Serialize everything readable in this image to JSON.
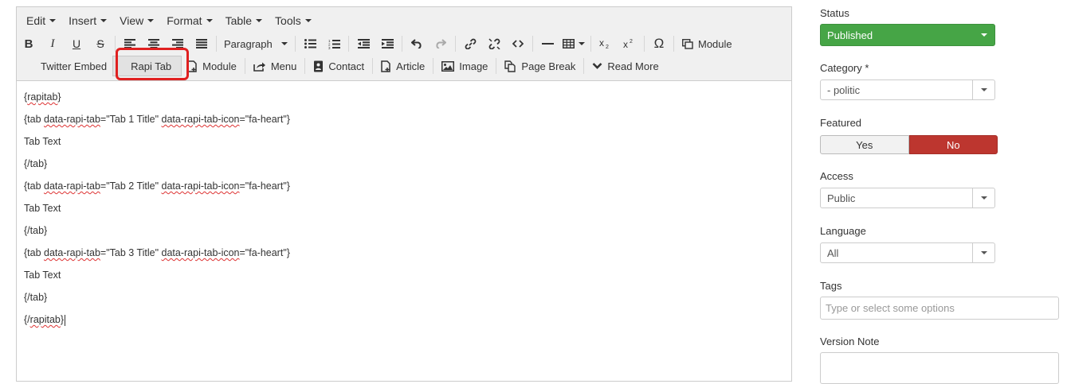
{
  "menubar": [
    "Edit",
    "Insert",
    "View",
    "Format",
    "Table",
    "Tools"
  ],
  "toolbar": {
    "format_select": "Paragraph",
    "module_label": "Module",
    "twitter_label": "Twitter Embed",
    "rapi_tab_label": "Rapi Tab",
    "module2_label": "Module",
    "menu_label": "Menu",
    "contact_label": "Contact",
    "article_label": "Article",
    "image_label": "Image",
    "pagebreak_label": "Page Break",
    "readmore_label": "Read More"
  },
  "content": {
    "lines": [
      "{rapitab}",
      "{tab data-rapi-tab=\"Tab 1 Title\" data-rapi-tab-icon=\"fa-heart\"}",
      "Tab Text",
      "{/tab}",
      "{tab data-rapi-tab=\"Tab 2 Title\" data-rapi-tab-icon=\"fa-heart\"}",
      "Tab Text",
      "{/tab}",
      "{tab data-rapi-tab=\"Tab 3 Title\" data-rapi-tab-icon=\"fa-heart\"}",
      "Tab Text",
      "{/tab}",
      "{/rapitab}"
    ]
  },
  "sidebar": {
    "status_label": "Status",
    "status_value": "Published",
    "category_label": "Category *",
    "category_value": "- politic",
    "featured_label": "Featured",
    "featured_yes": "Yes",
    "featured_no": "No",
    "access_label": "Access",
    "access_value": "Public",
    "language_label": "Language",
    "language_value": "All",
    "tags_label": "Tags",
    "tags_placeholder": "Type or select some options",
    "version_note_label": "Version Note"
  },
  "colors": {
    "published": "#46a546",
    "no_active": "#bd362f",
    "highlight": "#e02020"
  }
}
